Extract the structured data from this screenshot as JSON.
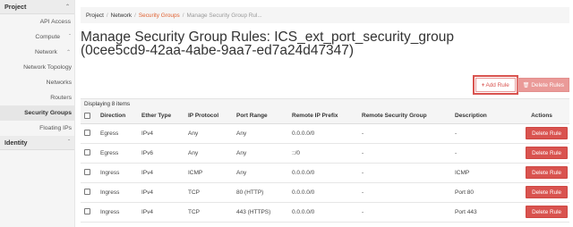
{
  "sidebar": {
    "project_label": "Project",
    "items": [
      {
        "label": "API Access"
      },
      {
        "label": "Compute"
      },
      {
        "label": "Network"
      },
      {
        "label": "Network Topology"
      },
      {
        "label": "Networks"
      },
      {
        "label": "Routers"
      },
      {
        "label": "Security Groups"
      },
      {
        "label": "Floating IPs"
      }
    ],
    "identity_label": "Identity"
  },
  "breadcrumb": {
    "project": "Project",
    "network": "Network",
    "security_groups": "Security Groups",
    "current": "Manage Security Group Rul..."
  },
  "page": {
    "title_line1": "Manage Security Group Rules: ICS_ext_port_security_group",
    "title_line2": "(0cee5cd9-42aa-4abe-9aa7-ed7a24d47347)"
  },
  "actions": {
    "add_rule": "Add Rule",
    "delete_rules": "Delete Rules"
  },
  "table": {
    "count_text": "Displaying 8 items",
    "columns": [
      "Direction",
      "Ether Type",
      "IP Protocol",
      "Port Range",
      "Remote IP Prefix",
      "Remote Security Group",
      "Description",
      "Actions"
    ],
    "rows": [
      {
        "direction": "Egress",
        "ether": "IPv4",
        "protocol": "Any",
        "port": "Any",
        "prefix": "0.0.0.0/0",
        "group": "-",
        "desc": "-",
        "action": "Delete Rule"
      },
      {
        "direction": "Egress",
        "ether": "IPv6",
        "protocol": "Any",
        "port": "Any",
        "prefix": "::/0",
        "group": "-",
        "desc": "-",
        "action": "Delete Rule"
      },
      {
        "direction": "Ingress",
        "ether": "IPv4",
        "protocol": "ICMP",
        "port": "Any",
        "prefix": "0.0.0.0/0",
        "group": "-",
        "desc": "ICMP",
        "action": "Delete Rule"
      },
      {
        "direction": "Ingress",
        "ether": "IPv4",
        "protocol": "TCP",
        "port": "80 (HTTP)",
        "prefix": "0.0.0.0/0",
        "group": "-",
        "desc": "Port 80",
        "action": "Delete Rule"
      },
      {
        "direction": "Ingress",
        "ether": "IPv4",
        "protocol": "TCP",
        "port": "443 (HTTPS)",
        "prefix": "0.0.0.0/0",
        "group": "-",
        "desc": "Port 443",
        "action": "Delete Rule"
      }
    ]
  },
  "colors": {
    "accent": "#d9534f",
    "breadcrumb_active": "#e06030"
  }
}
